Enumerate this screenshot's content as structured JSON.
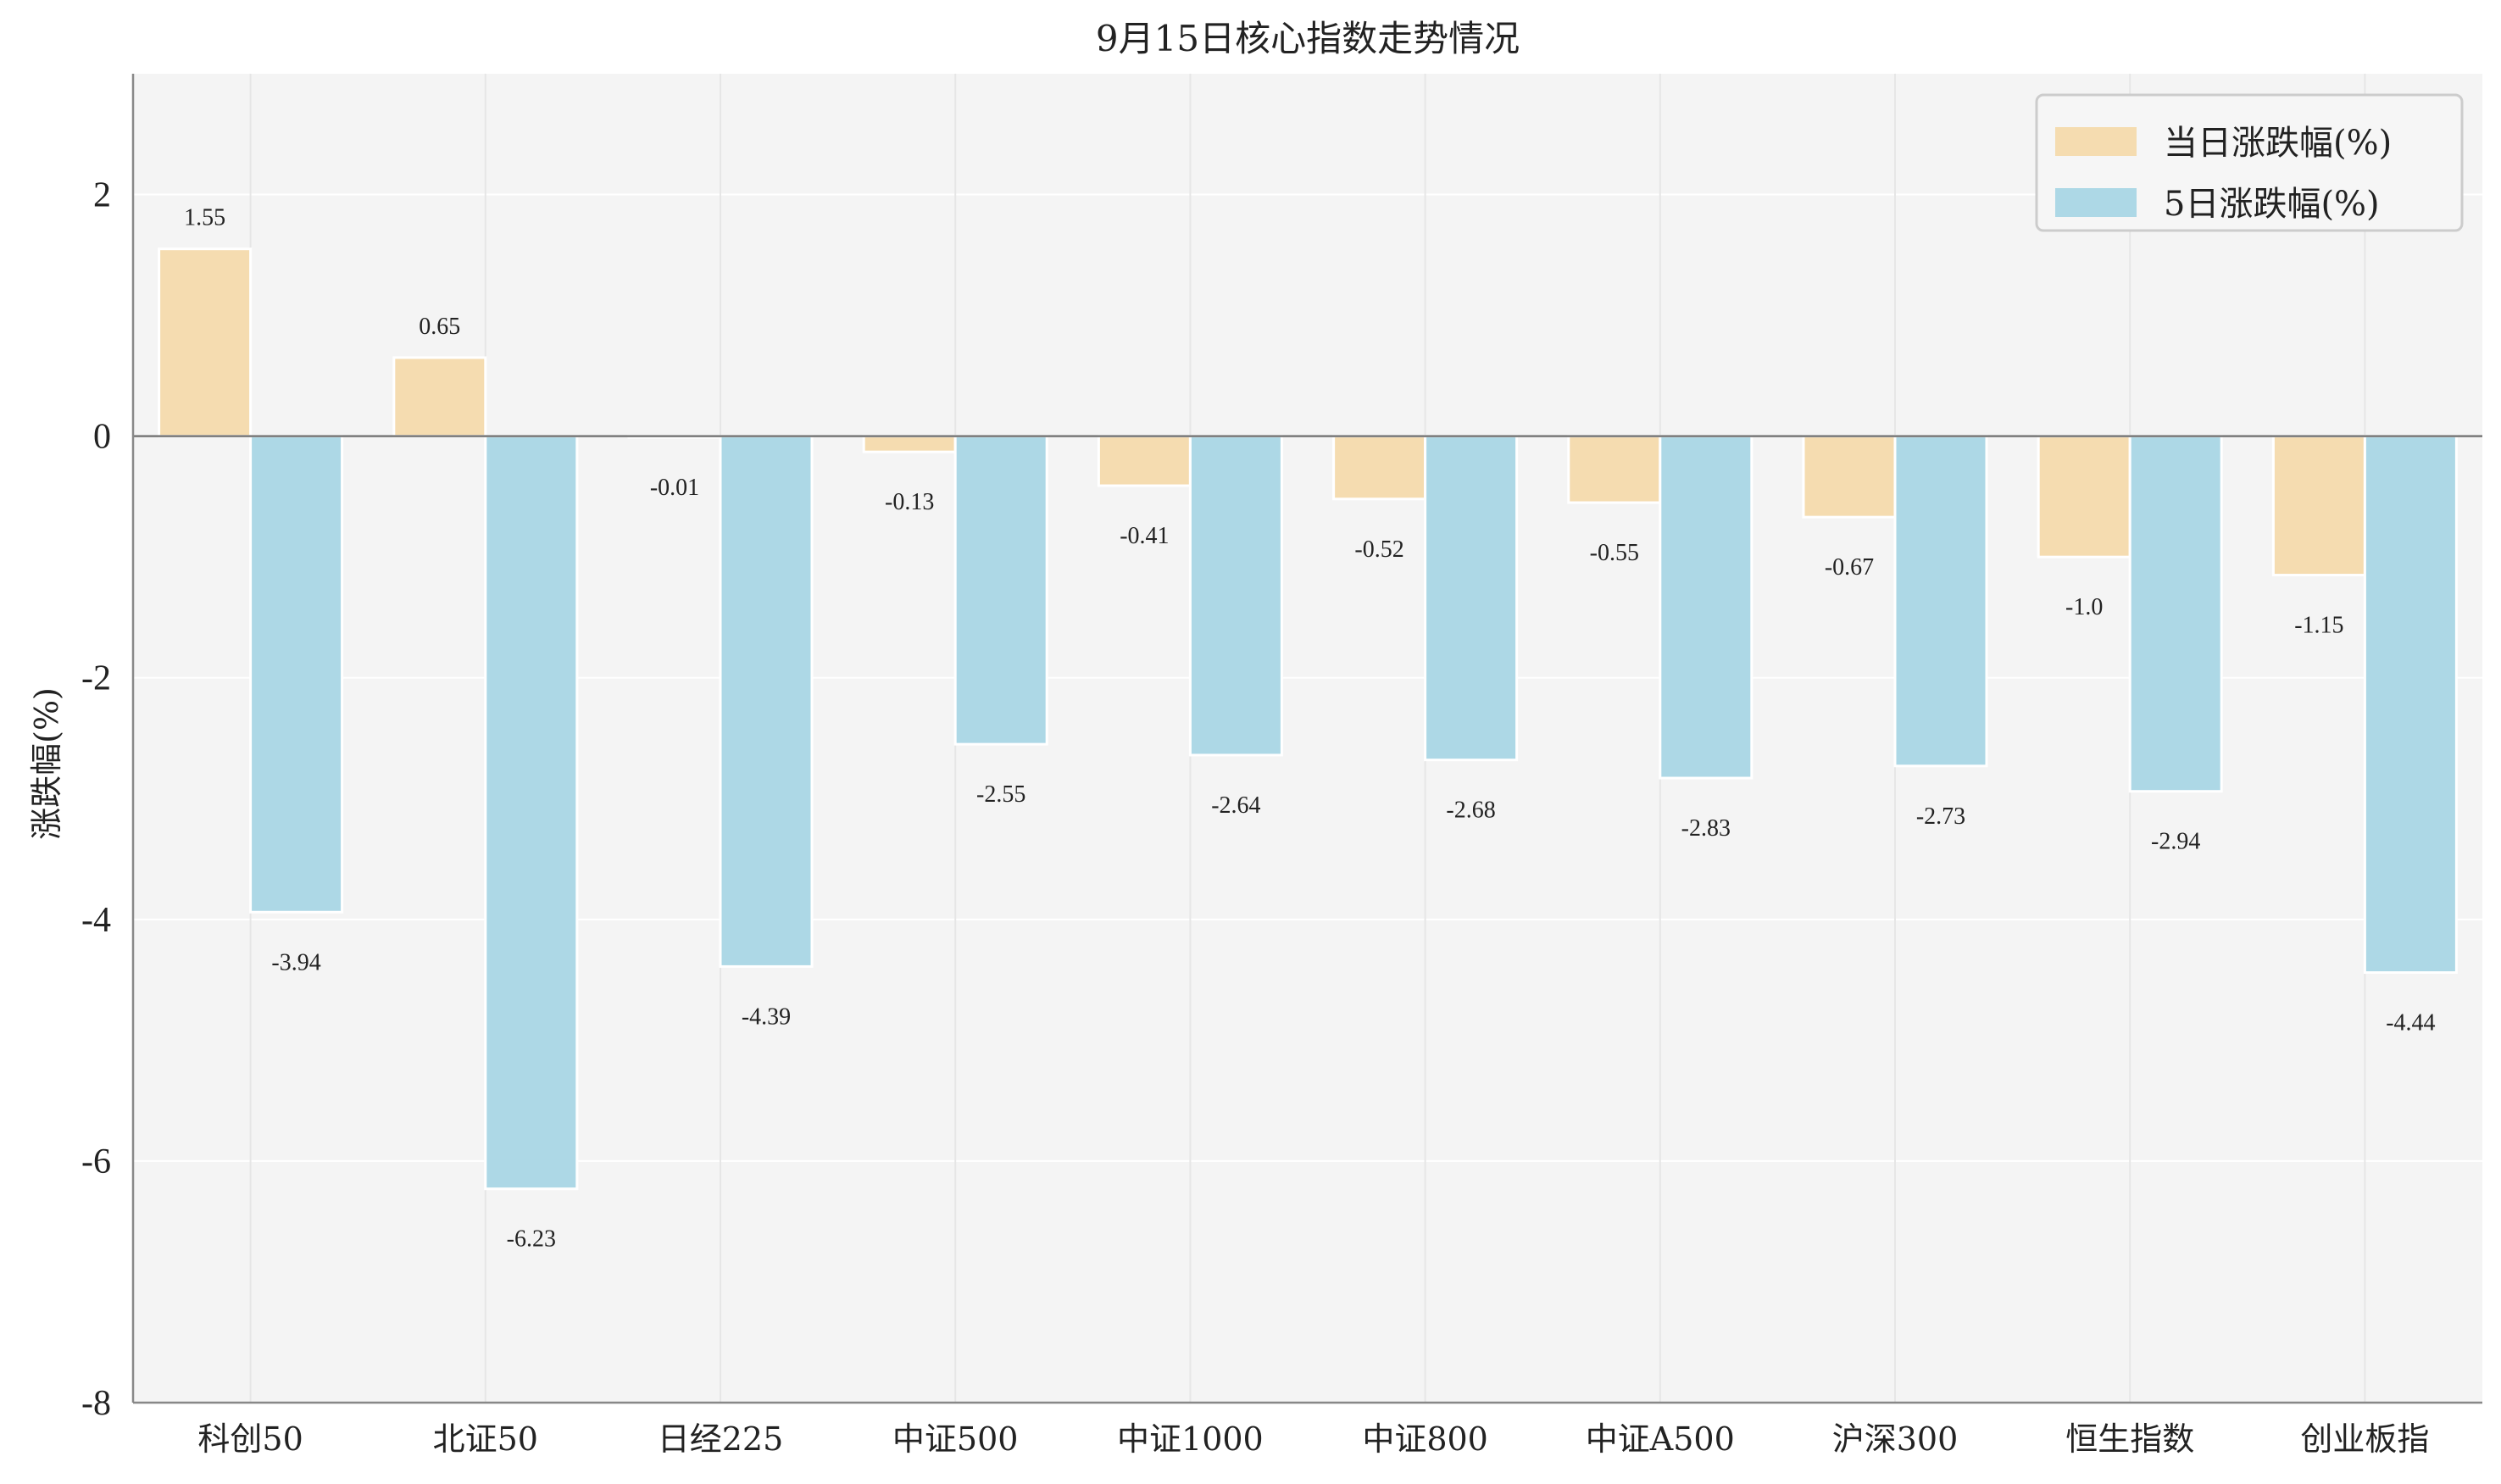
{
  "chart_data": {
    "type": "bar",
    "title": "9月15日核心指数走势情况",
    "xlabel": "",
    "ylabel": "涨跌幅(%)",
    "ylim": [
      -8,
      3
    ],
    "yticks": [
      2,
      0,
      -2,
      -4,
      -6,
      -8
    ],
    "grid": true,
    "legend_position": "top-right",
    "categories": [
      "科创50",
      "北证50",
      "日经225",
      "中证500",
      "中证1000",
      "中证800",
      "中证A500",
      "沪深300",
      "恒生指数",
      "创业板指"
    ],
    "series": [
      {
        "name": "当日涨跌幅(%)",
        "color": "#f5dcb0",
        "values": [
          1.55,
          0.65,
          -0.01,
          -0.13,
          -0.41,
          -0.52,
          -0.55,
          -0.67,
          -1.0,
          -1.15
        ],
        "labels": [
          "1.55",
          "0.65",
          "-0.01",
          "-0.13",
          "-0.41",
          "-0.52",
          "-0.55",
          "-0.67",
          "-1.0",
          "-1.15"
        ]
      },
      {
        "name": "5日涨跌幅(%)",
        "color": "#add8e6",
        "values": [
          -3.94,
          -6.23,
          -4.39,
          -2.55,
          -2.64,
          -2.68,
          -2.83,
          -2.73,
          -2.94,
          -4.44
        ],
        "labels": [
          "-3.94",
          "-6.23",
          "-4.39",
          "-2.55",
          "-2.64",
          "-2.68",
          "-2.83",
          "-2.73",
          "-2.94",
          "-4.44"
        ]
      }
    ],
    "colors": {
      "plot_background": "#f4f4f4",
      "grid": "#e6e6e6",
      "axis": "#888888",
      "bar_edge": "#ffffff"
    }
  }
}
